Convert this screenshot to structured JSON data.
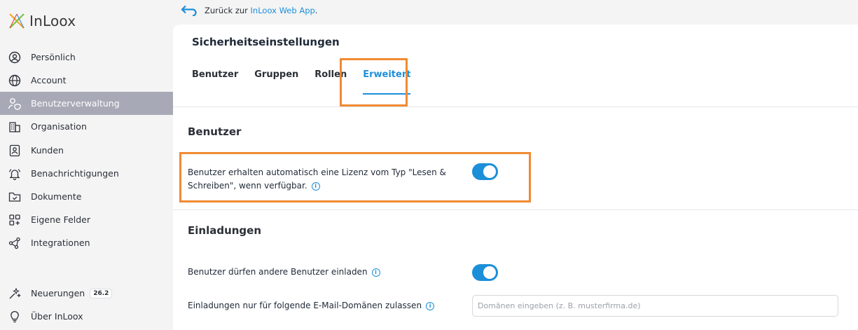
{
  "app": {
    "name": "InLoox"
  },
  "colors": {
    "accent": "#1d8fd9",
    "highlight": "#f08a33",
    "active_nav": "#a7a9b6"
  },
  "back": {
    "prefix": "Zurück zur ",
    "link": "InLoox Web App",
    "suffix": "."
  },
  "sidebar": {
    "items": [
      {
        "label": "Persönlich",
        "icon": "user-circle-icon"
      },
      {
        "label": "Account",
        "icon": "globe-icon"
      },
      {
        "label": "Benutzerverwaltung",
        "icon": "user-shield-icon",
        "active": true
      },
      {
        "label": "Organisation",
        "icon": "building-icon"
      },
      {
        "label": "Kunden",
        "icon": "contact-card-icon"
      },
      {
        "label": "Benachrichtigungen",
        "icon": "bell-icon"
      },
      {
        "label": "Dokumente",
        "icon": "folder-check-icon"
      },
      {
        "label": "Eigene Felder",
        "icon": "grid-plus-icon"
      },
      {
        "label": "Integrationen",
        "icon": "share-nodes-icon"
      }
    ],
    "bottom": [
      {
        "label": "Neuerungen",
        "badge": "26.2",
        "icon": "sparkle-icon"
      },
      {
        "label": "Über InLoox",
        "icon": "lightbulb-icon"
      }
    ]
  },
  "page": {
    "title": "Sicherheitseinstellungen",
    "tabs": [
      {
        "label": "Benutzer"
      },
      {
        "label": "Gruppen"
      },
      {
        "label": "Rollen"
      },
      {
        "label": "Erweitert",
        "active": true
      }
    ]
  },
  "sections": {
    "users": {
      "title": "Benutzer",
      "setting_line1": "Benutzer erhalten automatisch eine Lizenz vom Typ \"Lesen &",
      "setting_line2": "Schreiben\", wenn verfügbar.",
      "enabled": true
    },
    "invitations": {
      "title": "Einladungen",
      "allow_invite": "Benutzer dürfen andere Benutzer einladen",
      "allow_invite_enabled": true,
      "domains_label": "Einladungen nur für folgende E-Mail-Domänen zulassen",
      "domains_placeholder": "Domänen eingeben (z. B. musterfirma.de)",
      "domains_value": ""
    }
  }
}
